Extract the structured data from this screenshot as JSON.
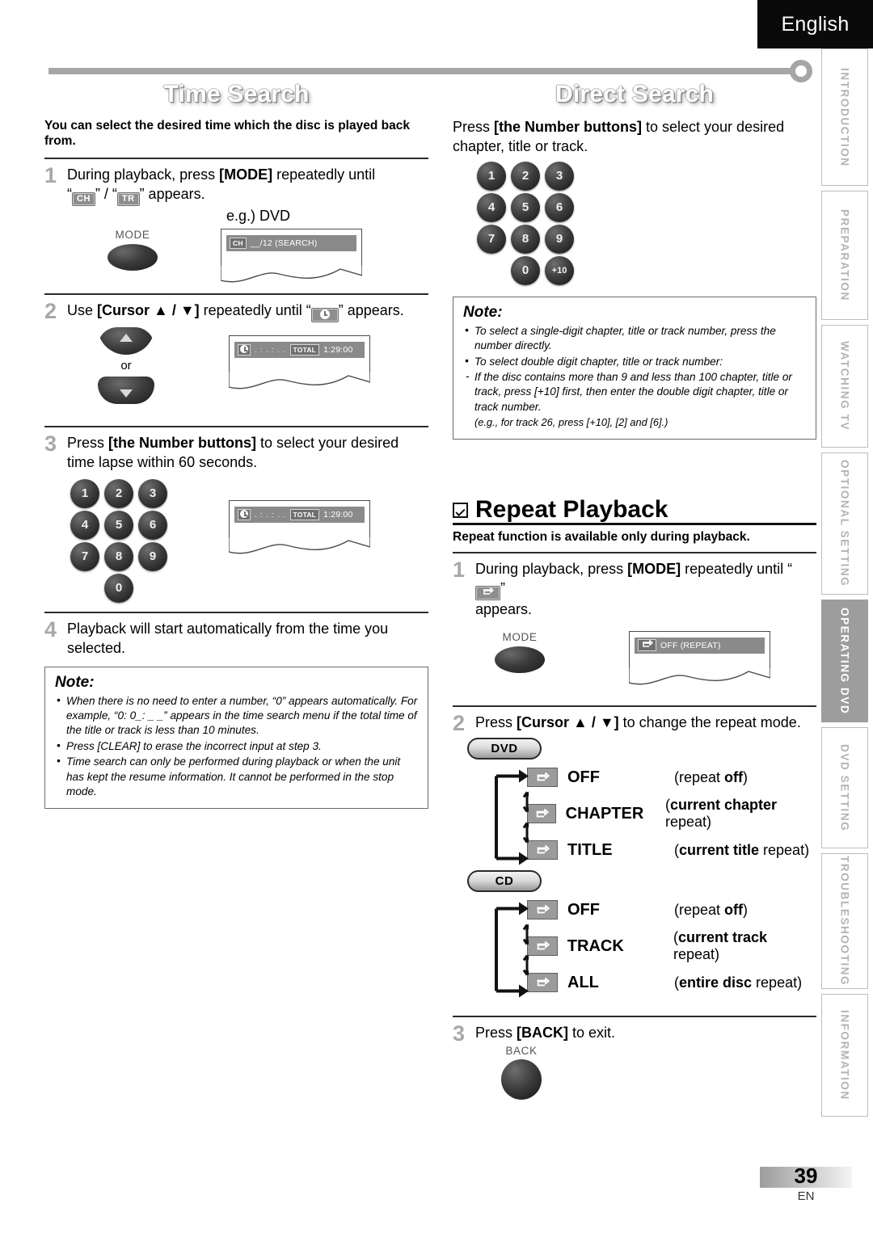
{
  "header": {
    "language": "English"
  },
  "side_tabs": [
    {
      "label": "INTRODUCTION",
      "active": false
    },
    {
      "label": "PREPARATION",
      "active": false
    },
    {
      "label": "WATCHING TV",
      "active": false
    },
    {
      "label": "OPTIONAL SETTING",
      "active": false
    },
    {
      "label": "OPERATING DVD",
      "active": true
    },
    {
      "label": "DVD SETTING",
      "active": false
    },
    {
      "label": "TROUBLESHOOTING",
      "active": false
    },
    {
      "label": "INFORMATION",
      "active": false
    }
  ],
  "time_search": {
    "banner": "Time Search",
    "lede": "You can select the desired time which the disc is played back from.",
    "step1": {
      "num": "1",
      "line1_a": "During playback, press ",
      "line1_b": "[MODE]",
      "line1_c": " repeatedly until",
      "line2_quote_open": "“",
      "chip_ch": "CH",
      "line2_mid": "” / “",
      "chip_tr": "TR",
      "line2_end": "” appears.",
      "eg_label": "e.g.) DVD",
      "button_label": "MODE",
      "osd_mini": "CH",
      "osd_text": "__/12 (SEARCH)"
    },
    "step2": {
      "num": "2",
      "text_a": "Use ",
      "text_b": "[Cursor ▲ / ▼]",
      "text_c": " repeatedly until “",
      "text_d": "” appears.",
      "or_label": "or",
      "osd_dots": ".  :  .  :  .  .",
      "osd_total": "TOTAL",
      "osd_time": "1:29:00"
    },
    "step3": {
      "num": "3",
      "text_a": "Press ",
      "text_b": "[the Number buttons]",
      "text_c": " to select your desired",
      "line2": "time lapse within 60 seconds.",
      "keys": [
        "1",
        "2",
        "3",
        "4",
        "5",
        "6",
        "7",
        "8",
        "9",
        "",
        "0",
        ""
      ],
      "osd_dots": ".  :  .  :  .  .",
      "osd_total": "TOTAL",
      "osd_time": "1:29:00"
    },
    "step4": {
      "num": "4",
      "line1": "Playback will start automatically from the time you",
      "line2": "selected."
    },
    "note": {
      "title": "Note:",
      "items": [
        {
          "type": "bullet",
          "text": "When there is no need to enter a number, “0” appears automatically. For example, “0: 0_: _ _” appears in the time search menu if the total time of the title or track is less than 10 minutes."
        },
        {
          "type": "bullet",
          "text": "Press [CLEAR] to erase the incorrect input at step 3."
        },
        {
          "type": "bullet",
          "text": "Time search can only be performed during playback or when the unit has kept the resume information. It cannot be performed in the stop mode."
        }
      ]
    }
  },
  "direct_search": {
    "banner": "Direct Search",
    "intro_a": "Press ",
    "intro_b": "[the Number buttons]",
    "intro_c": " to select your desired",
    "intro_line2": "chapter, title or track.",
    "keys": [
      "1",
      "2",
      "3",
      "4",
      "5",
      "6",
      "7",
      "8",
      "9",
      "",
      "0",
      "+10"
    ],
    "note": {
      "title": "Note:",
      "items": [
        {
          "type": "bullet",
          "text": "To select a single-digit chapter, title or track number, press the number directly."
        },
        {
          "type": "bullet",
          "text": "To select double digit chapter, title or track number:"
        },
        {
          "type": "dash",
          "text": "If the disc contains more than 9 and less than 100 chapter, title or track, press [+10] first, then enter the double digit chapter, title or track number."
        },
        {
          "type": "plain",
          "text": "(e.g., for track 26, press [+10], [2] and [6].)"
        }
      ]
    }
  },
  "repeat_playback": {
    "title": "Repeat Playback",
    "lede": "Repeat function is available only during playback.",
    "step1": {
      "num": "1",
      "text_a": "During playback, press ",
      "text_b": "[MODE]",
      "text_c": " repeatedly until “",
      "text_d": "”",
      "line2": "appears.",
      "button_label": "MODE",
      "osd_text": "OFF  (REPEAT)"
    },
    "step2": {
      "num": "2",
      "text_a": "Press ",
      "text_b": "[Cursor ▲ / ▼]",
      "text_c": " to change the repeat mode.",
      "dvd_pill": "DVD",
      "dvd_modes": [
        {
          "mode": "OFF",
          "desc_pre": "(repeat ",
          "desc_bold": "off",
          "desc_post": ")"
        },
        {
          "mode": "CHAPTER",
          "desc_pre": "(",
          "desc_bold": "current chapter",
          "desc_post": " repeat)"
        },
        {
          "mode": "TITLE",
          "desc_pre": "(",
          "desc_bold": "current title",
          "desc_post": " repeat)"
        }
      ],
      "cd_pill": "CD",
      "cd_modes": [
        {
          "mode": "OFF",
          "desc_pre": "(repeat ",
          "desc_bold": "off",
          "desc_post": ")"
        },
        {
          "mode": "TRACK",
          "desc_pre": "(",
          "desc_bold": "current track",
          "desc_post": " repeat)"
        },
        {
          "mode": "ALL",
          "desc_pre": "(",
          "desc_bold": "entire disc",
          "desc_post": " repeat)"
        }
      ]
    },
    "step3": {
      "num": "3",
      "text_a": "Press ",
      "text_b": "[BACK]",
      "text_c": " to exit.",
      "button_label": "BACK"
    }
  },
  "footer": {
    "page_number": "39",
    "page_code": "EN"
  }
}
